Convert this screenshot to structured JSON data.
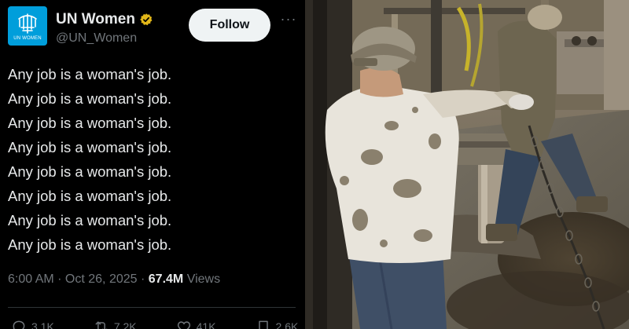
{
  "tweet": {
    "author": {
      "display_name": "UN Women",
      "handle": "@UN_Women",
      "avatar_label": "UN WOMEN",
      "verified_badge": "verified-badge-icon"
    },
    "follow_label": "Follow",
    "more_label": "···",
    "body_lines": [
      "Any job is a woman's job.",
      "Any job is a woman's job.",
      "Any job is a woman's job.",
      "Any job is a woman's job.",
      "Any job is a woman's job.",
      "Any job is a woman's job.",
      "Any job is a woman's job.",
      "Any job is a woman's job."
    ],
    "meta": {
      "time": "6:00 AM",
      "separator": " · ",
      "date": "Oct 26, 2025",
      "views_count": "67.4M",
      "views_label": "Views"
    },
    "actions": [
      {
        "icon": "reply-icon",
        "count": "3.1K"
      },
      {
        "icon": "repost-icon",
        "count": "7.2K"
      },
      {
        "icon": "like-icon",
        "count": "41K"
      },
      {
        "icon": "bookmark-icon",
        "count": "2.6K"
      },
      {
        "icon": "share-icon",
        "count": ""
      }
    ]
  },
  "photo": {
    "subject": "oil-rig-worker-photo"
  },
  "colors": {
    "background": "#000000",
    "text": "#e7e9ea",
    "muted": "#71767b",
    "un_blue": "#009edb",
    "verified_gold": "#e2b719"
  }
}
